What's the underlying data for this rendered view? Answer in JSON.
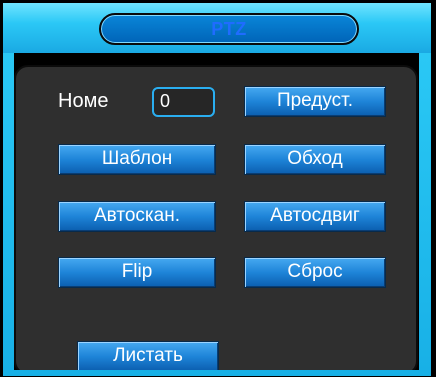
{
  "dialog": {
    "title": "PTZ",
    "home_label": "Номе",
    "home_value": "0"
  },
  "buttons": {
    "preset": "Предуст.",
    "template": "Шаблон",
    "tour": "Обход",
    "autoscan": "Автоскан.",
    "autopan": "Автосдвиг",
    "flip": "Flip",
    "reset": "Сброс",
    "page": "Листать"
  },
  "colors": {
    "header": "#2bc8f6",
    "title_text": "#1f6cff",
    "panel": "#2f2f2f",
    "button": "#1e84d8"
  }
}
